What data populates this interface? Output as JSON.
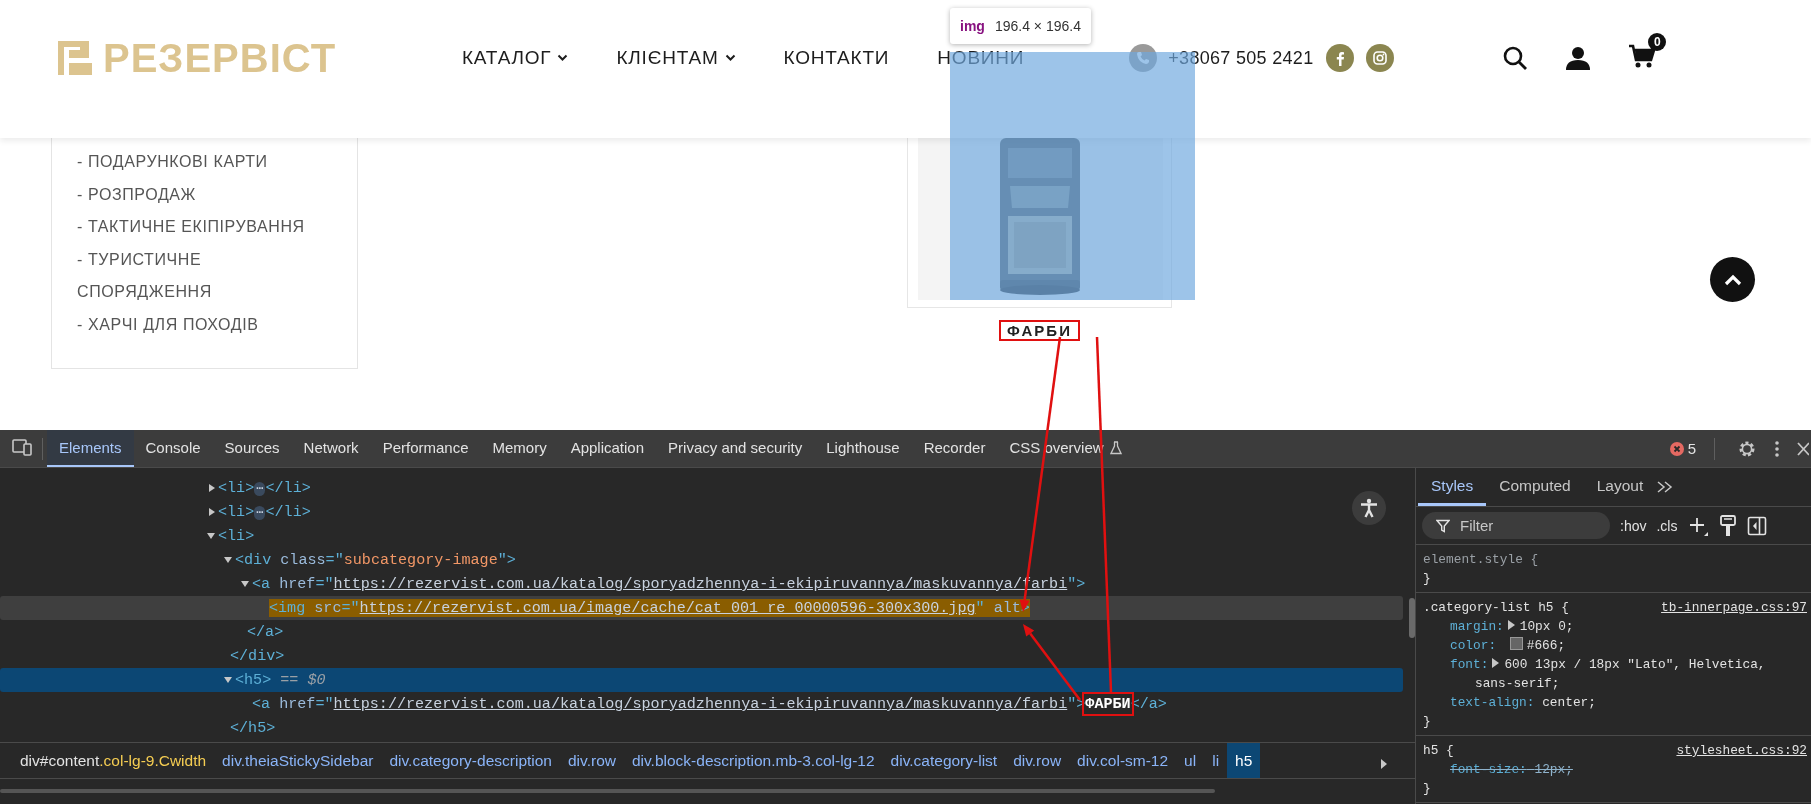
{
  "tooltip": {
    "tag": "img",
    "size": "196.4 × 196.4"
  },
  "site": {
    "logo": "РЕЗЕРВІСТ",
    "nav": [
      {
        "label": "КАТАЛОГ",
        "dropdown": true
      },
      {
        "label": "КЛІЄНТАМ",
        "dropdown": true
      },
      {
        "label": "КОНТАКТИ",
        "dropdown": false
      },
      {
        "label": "НОВИНИ",
        "dropdown": false
      }
    ],
    "phone": "+38067 505 2421",
    "cart_count": "0",
    "sidebar_items": [
      "- ПОДАРУНКОВІ КАРТИ",
      "- РОЗПРОДАЖ",
      "- ТАКТИЧНЕ ЕКІПІРУВАННЯ",
      "- ТУРИСТИЧНЕ СПОРЯДЖЕННЯ",
      "- ХАРЧІ ДЛЯ ПОХОДІВ"
    ],
    "category": {
      "title": "ФАРБИ",
      "boxed": true
    }
  },
  "devtools": {
    "tabs": [
      {
        "label": "Elements",
        "selected": true,
        "experimental": false
      },
      {
        "label": "Console",
        "selected": false,
        "experimental": false
      },
      {
        "label": "Sources",
        "selected": false,
        "experimental": false
      },
      {
        "label": "Network",
        "selected": false,
        "experimental": false
      },
      {
        "label": "Performance",
        "selected": false,
        "experimental": false
      },
      {
        "label": "Memory",
        "selected": false,
        "experimental": false
      },
      {
        "label": "Application",
        "selected": false,
        "experimental": false
      },
      {
        "label": "Privacy and security",
        "selected": false,
        "experimental": false
      },
      {
        "label": "Lighthouse",
        "selected": false,
        "experimental": false
      },
      {
        "label": "Recorder",
        "selected": false,
        "experimental": false
      },
      {
        "label": "CSS overview",
        "selected": false,
        "experimental": true
      }
    ],
    "errors": "5",
    "dom_tree": [
      {
        "tokens": [
          {
            "t": "<li>",
            "kind": "tag"
          },
          {
            "t": "⋯",
            "kind": "badge"
          },
          {
            "t": "</li>",
            "kind": "tag"
          }
        ],
        "expanded": false,
        "selected": false,
        "hovered": false
      },
      {
        "tokens": [
          {
            "t": "<li>",
            "kind": "tag"
          },
          {
            "t": "⋯",
            "kind": "badge"
          },
          {
            "t": "</li>",
            "kind": "tag"
          }
        ],
        "expanded": false,
        "selected": false,
        "hovered": false
      },
      {
        "tokens": [
          {
            "t": "<li>",
            "kind": "tag"
          }
        ],
        "expanded": true,
        "selected": false,
        "hovered": false,
        "children": [
          {
            "tokens": [
              {
                "t": "<div ",
                "kind": "tag"
              },
              {
                "t": "class",
                "kind": "attr"
              },
              {
                "t": "=\"",
                "kind": "tag"
              },
              {
                "t": "subcategory-image",
                "kind": "value"
              },
              {
                "t": "\">",
                "kind": "tag"
              }
            ],
            "expanded": true,
            "selected": false,
            "hovered": false,
            "children": [
              {
                "tokens": [
                  {
                    "t": "<a ",
                    "kind": "tag"
                  },
                  {
                    "t": "href",
                    "kind": "attr"
                  },
                  {
                    "t": "=\"",
                    "kind": "tag"
                  },
                  {
                    "t": "https://rezervist.com.ua/katalog/sporyadzhennya-i-ekipiruvannya/maskuvannya/farbi",
                    "kind": "link"
                  },
                  {
                    "t": "\">",
                    "kind": "tag"
                  }
                ],
                "expanded": true,
                "selected": false,
                "hovered": false,
                "children": [
                  {
                    "tokens": [
                      {
                        "t": "<img ",
                        "kind": "tag"
                      },
                      {
                        "t": "src",
                        "kind": "attr"
                      },
                      {
                        "t": "=\"",
                        "kind": "tag"
                      },
                      {
                        "t": "https://rezervist.com.ua/image/cache/cat_001_re_00000596-300x300.jpg",
                        "kind": "link"
                      },
                      {
                        "t": "\" ",
                        "kind": "tag"
                      },
                      {
                        "t": "alt",
                        "kind": "attr"
                      },
                      {
                        "t": ">",
                        "kind": "tag"
                      }
                    ],
                    "selected": false,
                    "hovered": true
                  }
                ],
                "close": [
                  {
                    "t": "</a>",
                    "kind": "tag"
                  }
                ]
              }
            ],
            "close": [
              {
                "t": "</div>",
                "kind": "tag"
              }
            ]
          },
          {
            "tokens": [
              {
                "t": "<h5>",
                "kind": "tag"
              },
              {
                "t": "== $0",
                "kind": "marker"
              }
            ],
            "expanded": true,
            "selected": true,
            "hovered": false,
            "children": [
              {
                "tokens": [
                  {
                    "t": "<a ",
                    "kind": "tag"
                  },
                  {
                    "t": "href",
                    "kind": "attr"
                  },
                  {
                    "t": "=\"",
                    "kind": "tag"
                  },
                  {
                    "t": "https://rezervist.com.ua/katalog/sporyadzhennya-i-ekipiruvannya/maskuvannya/farbi",
                    "kind": "link"
                  },
                  {
                    "t": "\">",
                    "kind": "tag"
                  },
                  {
                    "t": "ФАРБИ",
                    "kind": "text",
                    "boxed": true
                  },
                  {
                    "t": "</a>",
                    "kind": "tag"
                  }
                ],
                "selected": false,
                "hovered": false
              }
            ],
            "close": [
              {
                "t": "</h5>",
                "kind": "tag"
              }
            ]
          }
        ]
      }
    ],
    "styles_tabs": [
      {
        "label": "Styles",
        "selected": true
      },
      {
        "label": "Computed",
        "selected": false
      },
      {
        "label": "Layout",
        "selected": false
      }
    ],
    "filter_placeholder": "Filter",
    "style_toggles": [
      ":hov",
      ".cls"
    ],
    "rules": [
      {
        "selector": "element.style {",
        "muted": true,
        "close": "}"
      },
      {
        "selector": ".category-list h5 {",
        "muted": false,
        "close": "}",
        "source": "tb-innerpage.css:97",
        "declarations": [
          {
            "property": "margin:",
            "value": "10px 0;",
            "expandable": true,
            "struck": false
          },
          {
            "property": "color:",
            "value": "#666;",
            "swatch": true,
            "expandable": false,
            "struck": false
          },
          {
            "property": "font:",
            "value": "600 13px / 18px \"Lato\", Helvetica, sans-serif;",
            "expandable": true,
            "struck": false
          },
          {
            "property": "text-align:",
            "value": "center;",
            "expandable": false,
            "struck": false
          }
        ]
      },
      {
        "selector": "h5 {",
        "muted": false,
        "close": "}",
        "source": "stylesheet.css:92",
        "declarations": [
          {
            "property": "font-size:",
            "value": "12px;",
            "expandable": false,
            "struck": true
          }
        ]
      }
    ],
    "breadcrumbs": [
      {
        "label": "div#content",
        "extra": ".col-lg-9.Cwidth",
        "selected": false
      },
      {
        "label": "div.theiaStickySidebar",
        "selected": false
      },
      {
        "label": "div.category-description",
        "selected": false
      },
      {
        "label": "div.row",
        "selected": false
      },
      {
        "label": "div.block-description.mb-3.col-lg-12",
        "selected": false
      },
      {
        "label": "div.category-list",
        "selected": false
      },
      {
        "label": "div.row",
        "selected": false
      },
      {
        "label": "div.col-sm-12",
        "selected": false
      },
      {
        "label": "ul",
        "selected": false
      },
      {
        "label": "li",
        "selected": false
      },
      {
        "label": "h5",
        "selected": true
      }
    ]
  }
}
